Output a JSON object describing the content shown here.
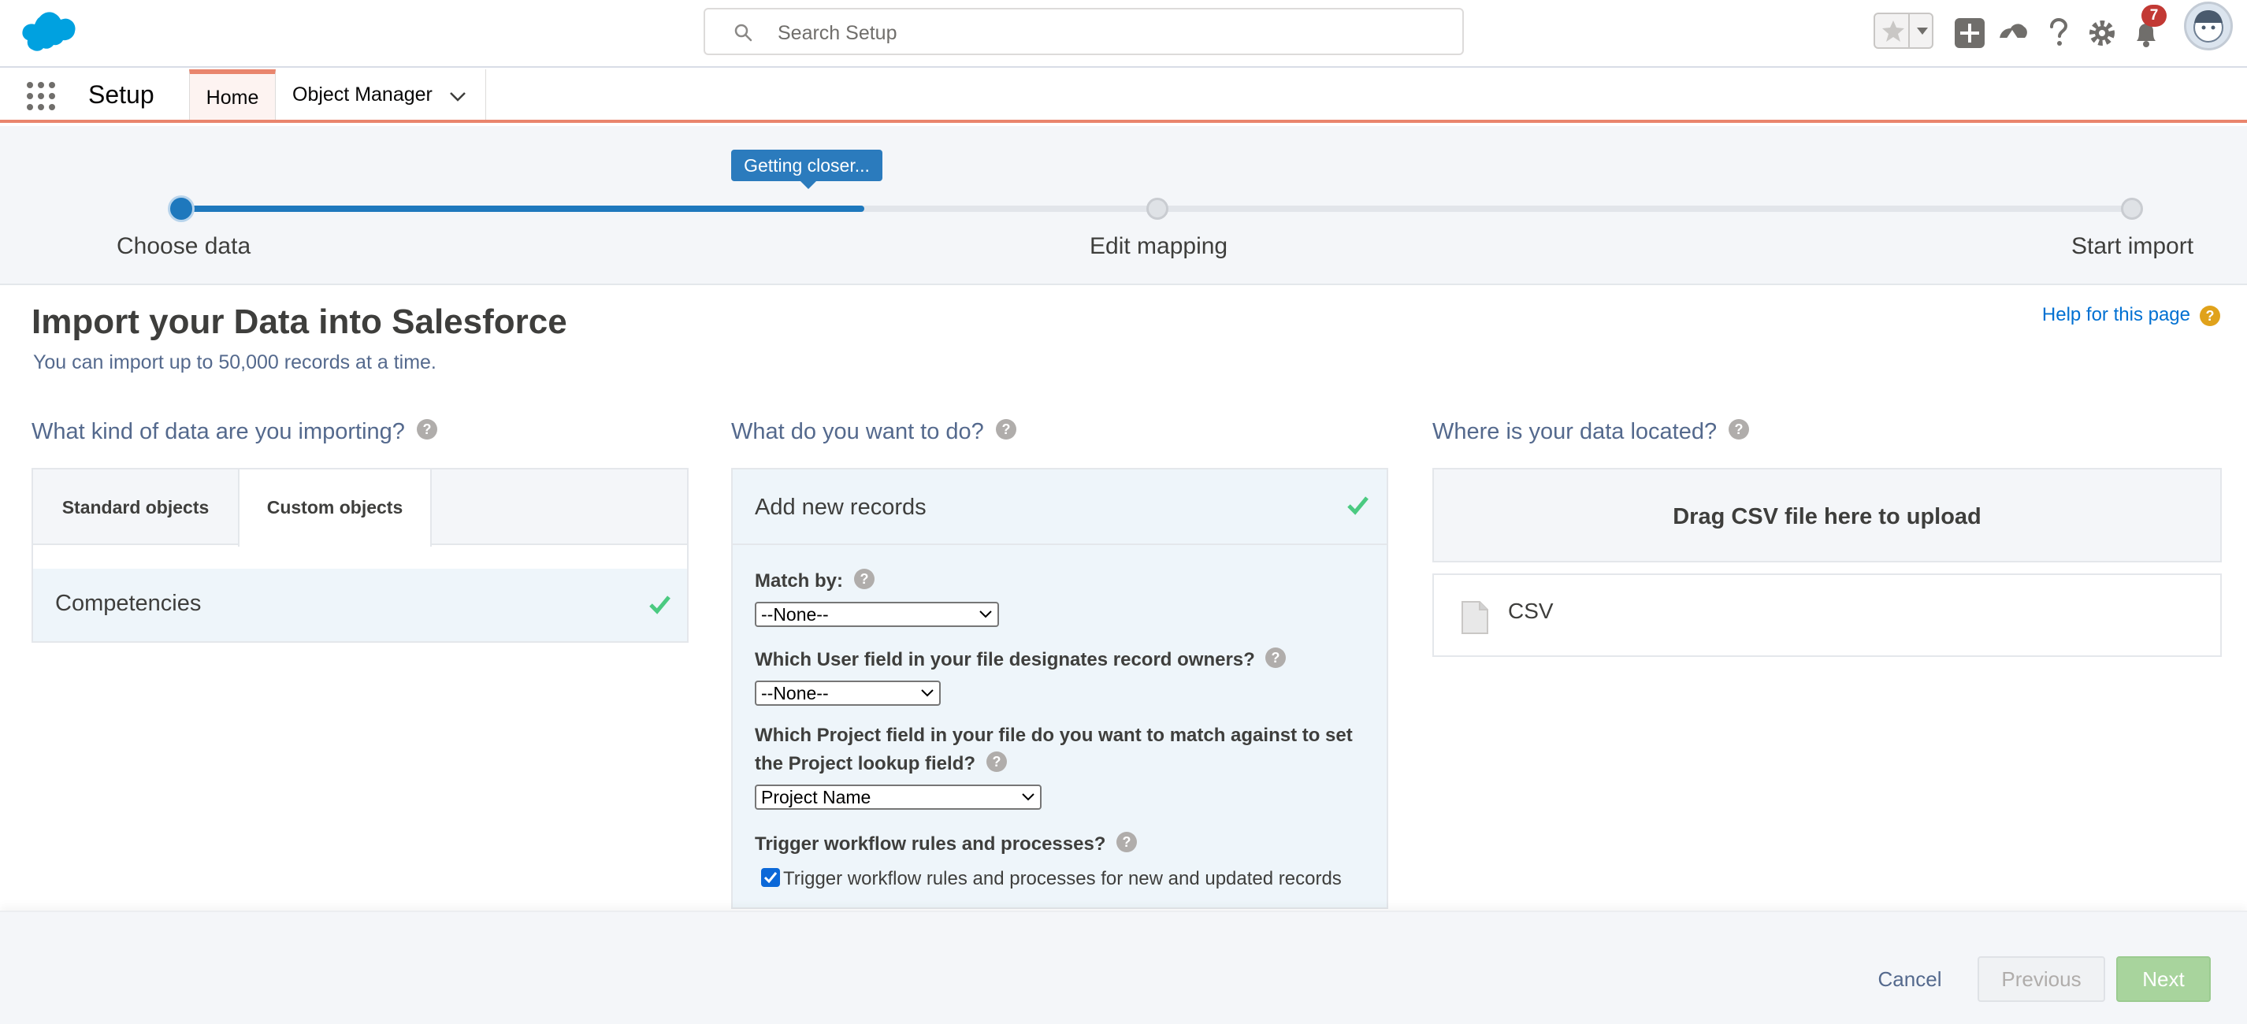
{
  "header": {
    "search_placeholder": "Search Setup",
    "notification_count": "7"
  },
  "app_nav": {
    "app_name": "Setup",
    "tabs": [
      {
        "label": "Home"
      },
      {
        "label": "Object Manager"
      }
    ]
  },
  "progress": {
    "tooltip": "Getting closer...",
    "fill_fraction": 0.35,
    "steps": [
      {
        "label": "Choose data"
      },
      {
        "label": "Edit mapping"
      },
      {
        "label": "Start import"
      }
    ]
  },
  "page": {
    "title": "Import your Data into Salesforce",
    "subtitle": "You can import up to 50,000 records at a time.",
    "help_link": "Help for this page"
  },
  "data_kind": {
    "title": "What kind of data are you importing?",
    "tabs": [
      {
        "label": "Standard objects"
      },
      {
        "label": "Custom objects"
      }
    ],
    "items": [
      {
        "label": "Competencies"
      }
    ]
  },
  "action": {
    "title": "What do you want to do?",
    "selected": "Add new records",
    "match_by_label": "Match by:",
    "match_by_value": "--None--",
    "owner_label": "Which User field in your file designates record owners?",
    "owner_value": "--None--",
    "project_label_line1": "Which Project field in your file do you want to match against to set",
    "project_label_line2": "the Project lookup field?",
    "project_value": "Project Name",
    "workflow_label": "Trigger workflow rules and processes?",
    "workflow_checkbox": "Trigger workflow rules and processes for new and updated records"
  },
  "location": {
    "title": "Where is your data located?",
    "drop_zone": "Drag CSV file here to upload",
    "sources": [
      {
        "label": "CSV"
      }
    ]
  },
  "footer": {
    "cancel": "Cancel",
    "previous": "Previous",
    "next": "Next"
  },
  "colors": {
    "brand_blue": "#1e78bd",
    "accent_coral": "#e9856d",
    "check_green": "#4bca81",
    "next_button": "#a8d49d"
  }
}
